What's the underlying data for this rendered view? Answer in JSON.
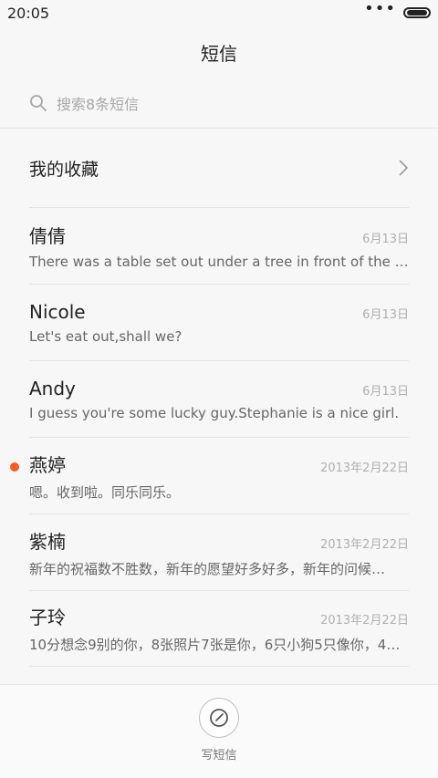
{
  "status": {
    "time": "20:05",
    "dots": "•••"
  },
  "header": {
    "title": "短信"
  },
  "search": {
    "placeholder": "搜索8条短信"
  },
  "favorites": {
    "label": "我的收藏"
  },
  "conversations": [
    {
      "name": "倩倩",
      "date": "6月13日",
      "preview": "There was a table set out under a tree in front of the ho…",
      "unread": false
    },
    {
      "name": "Nicole",
      "date": "6月13日",
      "preview": "Let's eat out,shall we?",
      "unread": false
    },
    {
      "name": "Andy",
      "date": "6月13日",
      "preview": "I guess you're some lucky guy.Stephanie is a nice girl.",
      "unread": false
    },
    {
      "name": "燕婷",
      "date": "2013年2月22日",
      "preview": "嗯。收到啦。同乐同乐。",
      "unread": true
    },
    {
      "name": "紫楠",
      "date": "2013年2月22日",
      "preview": "新年的祝福数不胜数，新年的愿望好多好多，新年的问候…",
      "unread": false
    },
    {
      "name": "子玲",
      "date": "2013年2月22日",
      "preview": "10分想念9别的你，8张照片7张是你，6只小狗5只像你，4…",
      "unread": false
    }
  ],
  "bottom": {
    "compose_label": "写短信"
  },
  "colors": {
    "unread_dot": "#ff5a1f"
  }
}
